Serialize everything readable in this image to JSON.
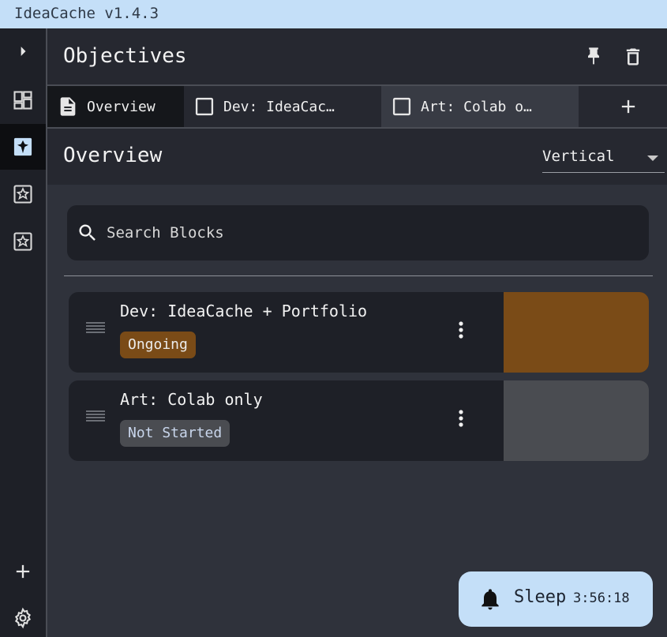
{
  "app": {
    "title": "IdeaCache v1.4.3"
  },
  "colors": {
    "accent": "#c4dff8",
    "ongoing": "#7a4b17",
    "not_started": "#4a4c51"
  },
  "rail": {
    "items": [
      {
        "icon": "chevron-right-icon"
      },
      {
        "icon": "dashboard-icon"
      },
      {
        "icon": "block-icon",
        "active": true
      },
      {
        "icon": "block-icon"
      },
      {
        "icon": "block-icon"
      }
    ],
    "add_icon": "plus-icon",
    "settings_icon": "gear-icon"
  },
  "header": {
    "title": "Objectives",
    "pin_icon": "pin-icon",
    "delete_icon": "trash-icon"
  },
  "tabs": [
    {
      "label": "Overview",
      "icon": "document-icon"
    },
    {
      "label": "Dev: IdeaCac…",
      "icon": "checkbox-icon"
    },
    {
      "label": "Art: Colab o…",
      "icon": "checkbox-icon"
    }
  ],
  "subheader": {
    "title": "Overview",
    "layout_select": {
      "value": "Vertical"
    }
  },
  "search": {
    "placeholder": "Search Blocks"
  },
  "blocks": [
    {
      "title": "Dev: IdeaCache + Portfolio",
      "status": "Ongoing",
      "color": "#7a4b17"
    },
    {
      "title": "Art: Colab only",
      "status": "Not Started",
      "color": "#4a4c51"
    }
  ],
  "timer": {
    "label": "Sleep",
    "time": "3:56:18",
    "icon": "bell-icon"
  }
}
